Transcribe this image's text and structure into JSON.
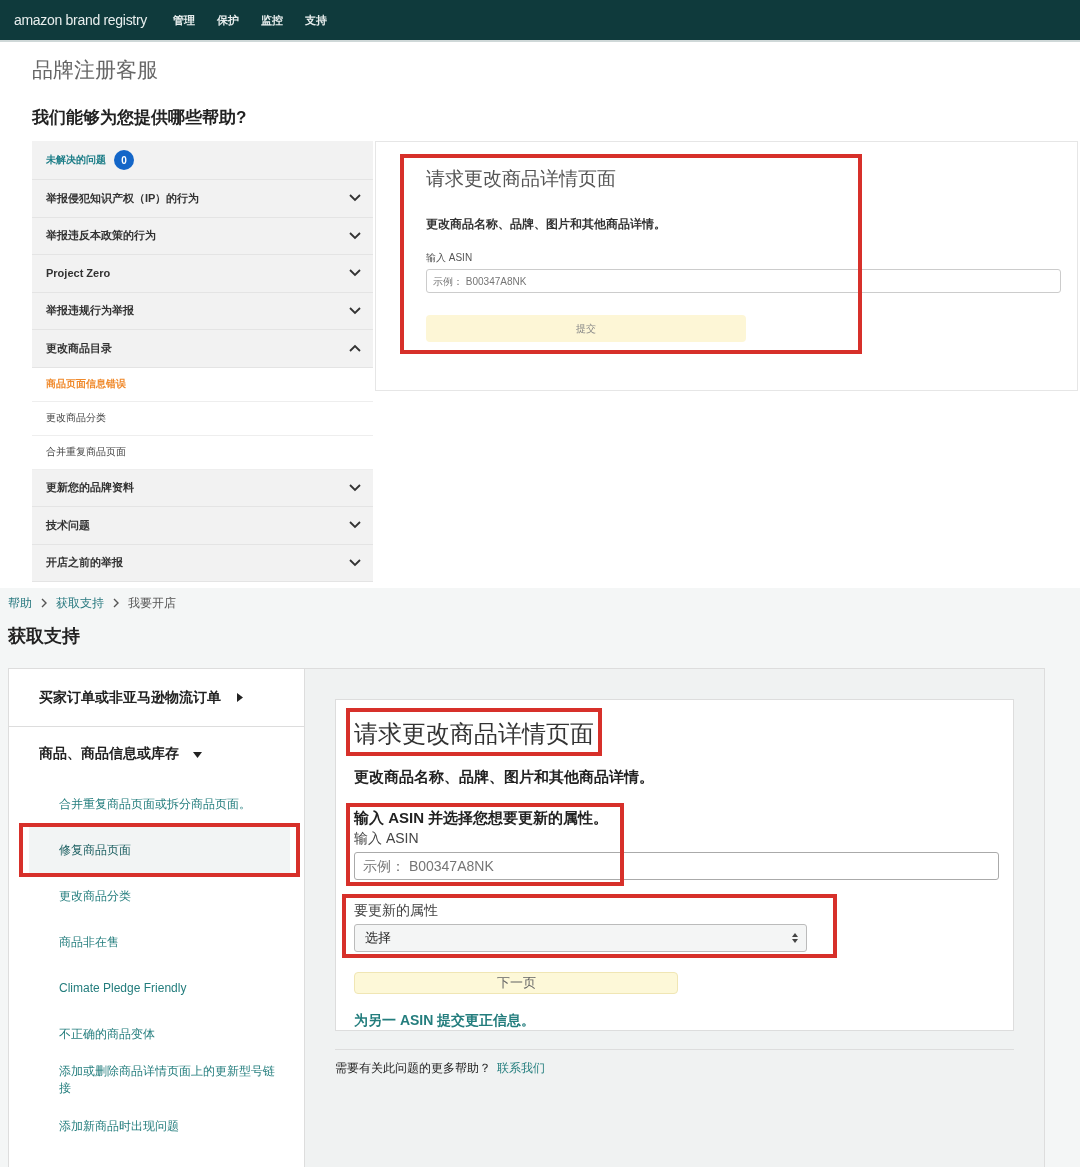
{
  "top_screen": {
    "nav_bar": {
      "logo": "amazon brand registry",
      "items": [
        "管理",
        "保护",
        "监控",
        "支持"
      ]
    },
    "page_title": "品牌注册客服",
    "heading": "我们能够为您提供哪些帮助?",
    "sidebar": {
      "items": [
        {
          "kind": "header",
          "label": "未解决的问题",
          "badge": "0"
        },
        {
          "kind": "section",
          "label": "举报侵犯知识产权（IP）的行为",
          "expanded": false
        },
        {
          "kind": "section",
          "label": "举报违反本政策的行为",
          "expanded": false
        },
        {
          "kind": "section",
          "label": "Project Zero",
          "expanded": false
        },
        {
          "kind": "section",
          "label": "举报违规行为举报",
          "expanded": false
        },
        {
          "kind": "section",
          "label": "更改商品目录",
          "expanded": true,
          "children": [
            {
              "label": "商品页面信息错误",
              "selected": true
            },
            {
              "label": "更改商品分类",
              "selected": false
            },
            {
              "label": "合并重复商品页面",
              "selected": false
            }
          ]
        },
        {
          "kind": "section",
          "label": "更新您的品牌资料",
          "expanded": false
        },
        {
          "kind": "section",
          "label": "技术问题",
          "expanded": false
        },
        {
          "kind": "section",
          "label": "开店之前的举报",
          "expanded": false
        }
      ]
    },
    "card": {
      "highlighted": true,
      "title": "请求更改商品详情页面",
      "description": "更改商品名称、品牌、图片和其他商品详情。",
      "asin_field": {
        "label": "输入 ASIN",
        "placeholder": "示例： B00347A8NK"
      },
      "submit_button": "提交"
    }
  },
  "bottom_screen": {
    "breadcrumb": [
      "帮助",
      "获取支持",
      "我要开店"
    ],
    "title": "获取支持",
    "nav": {
      "categories": [
        {
          "label": "买家订单或非亚马逊物流订单",
          "expanded": false
        },
        {
          "label": "商品、商品信息或库存",
          "expanded": true,
          "children": [
            {
              "label": "合并重复商品页面或拆分商品页面。",
              "selected": false,
              "highlighted": false
            },
            {
              "label": "修复商品页面",
              "selected": true,
              "highlighted": true
            },
            {
              "label": "更改商品分类",
              "selected": false,
              "highlighted": false
            },
            {
              "label": "商品非在售",
              "selected": false,
              "highlighted": false
            },
            {
              "label": "Climate Pledge Friendly",
              "selected": false,
              "highlighted": false
            },
            {
              "label": "不正确的商品变体",
              "selected": false,
              "highlighted": false
            },
            {
              "label": "添加或删除商品详情页面上的更新型号链接",
              "selected": false,
              "highlighted": false
            },
            {
              "label": "添加新商品时出现问题",
              "selected": false,
              "highlighted": false
            }
          ]
        }
      ]
    },
    "form": {
      "title": "请求更改商品详情页面",
      "title_highlighted": true,
      "description": "更改商品名称、品牌、图片和其他商品详情。",
      "asin_group": {
        "highlighted": true,
        "heading": "输入 ASIN 并选择您想要更新的属性。",
        "label": "输入 ASIN",
        "placeholder": "示例： B00347A8NK"
      },
      "attribute_group": {
        "highlighted": true,
        "label": "要更新的属性",
        "value": "选择"
      },
      "next_button": "下一页",
      "other_asin_link": "为另一 ASIN 提交更正信息。"
    },
    "help_text": "需要有关此问题的更多帮助？",
    "contact_link": "联系我们"
  }
}
